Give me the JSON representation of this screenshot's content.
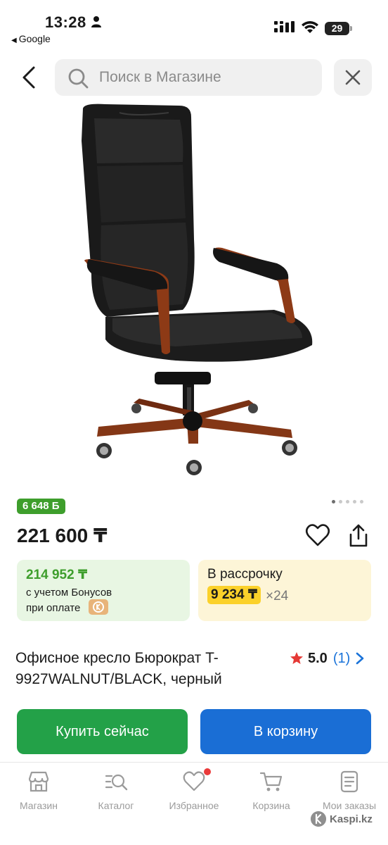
{
  "status_bar": {
    "time": "13:28",
    "back_app": "Google",
    "battery": "29"
  },
  "header": {
    "search_placeholder": "Поиск в Магазине"
  },
  "gallery": {
    "image_count": 5,
    "active_index": 0
  },
  "product": {
    "bonus_badge": "6 648 Б",
    "price": "221 600 ₸",
    "bonus_card": {
      "amount": "214 952 ₸",
      "line1": "с учетом Бонусов",
      "line2": "при оплате"
    },
    "installment_card": {
      "title": "В рассрочку",
      "monthly": "9 234 ₸",
      "months": "×24"
    },
    "title": "Офисное кресло Бюрократ T-9927WALNUT/BLACK, черный",
    "rating": {
      "score": "5.0",
      "count": "(1)"
    }
  },
  "actions": {
    "buy_now": "Купить сейчас",
    "to_cart": "В корзину"
  },
  "tabbar": {
    "items": [
      {
        "label": "Магазин",
        "icon": "store-icon"
      },
      {
        "label": "Каталог",
        "icon": "catalog-search-icon"
      },
      {
        "label": "Избранное",
        "icon": "heart-icon"
      },
      {
        "label": "Корзина",
        "icon": "cart-icon"
      },
      {
        "label": "Мои заказы",
        "icon": "orders-icon"
      }
    ]
  },
  "watermark": "Kaspi.kz",
  "colors": {
    "bonus_green": "#3e9e2c",
    "buy_green": "#23a148",
    "cart_blue": "#1a6ed5",
    "installment_yellow": "#fbd12a",
    "rating_star": "#e53935",
    "link_blue": "#1a73d9"
  }
}
